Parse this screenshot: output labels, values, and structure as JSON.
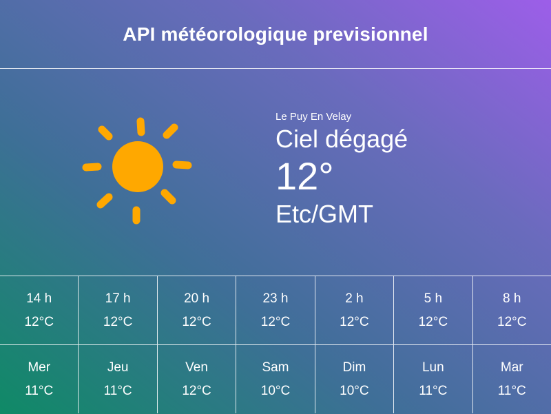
{
  "header": {
    "title": "API météorologique previsionnel"
  },
  "current": {
    "icon": "sun-icon",
    "city": "Le Puy En Velay",
    "description": "Ciel dégagé",
    "temperature": "12°",
    "timezone": "Etc/GMT"
  },
  "colors": {
    "sun": "#ffa800",
    "gradient_start": "#0f8a66",
    "gradient_end": "#9d5ee9",
    "text": "#ffffff"
  },
  "hourly": [
    {
      "time": "14 h",
      "temp": "12°C"
    },
    {
      "time": "17 h",
      "temp": "12°C"
    },
    {
      "time": "20 h",
      "temp": "12°C"
    },
    {
      "time": "23 h",
      "temp": "12°C"
    },
    {
      "time": "2 h",
      "temp": "12°C"
    },
    {
      "time": "5 h",
      "temp": "12°C"
    },
    {
      "time": "8 h",
      "temp": "12°C"
    }
  ],
  "daily": [
    {
      "day": "Mer",
      "temp": "11°C"
    },
    {
      "day": "Jeu",
      "temp": "11°C"
    },
    {
      "day": "Ven",
      "temp": "12°C"
    },
    {
      "day": "Sam",
      "temp": "10°C"
    },
    {
      "day": "Dim",
      "temp": "10°C"
    },
    {
      "day": "Lun",
      "temp": "11°C"
    },
    {
      "day": "Mar",
      "temp": "11°C"
    }
  ]
}
